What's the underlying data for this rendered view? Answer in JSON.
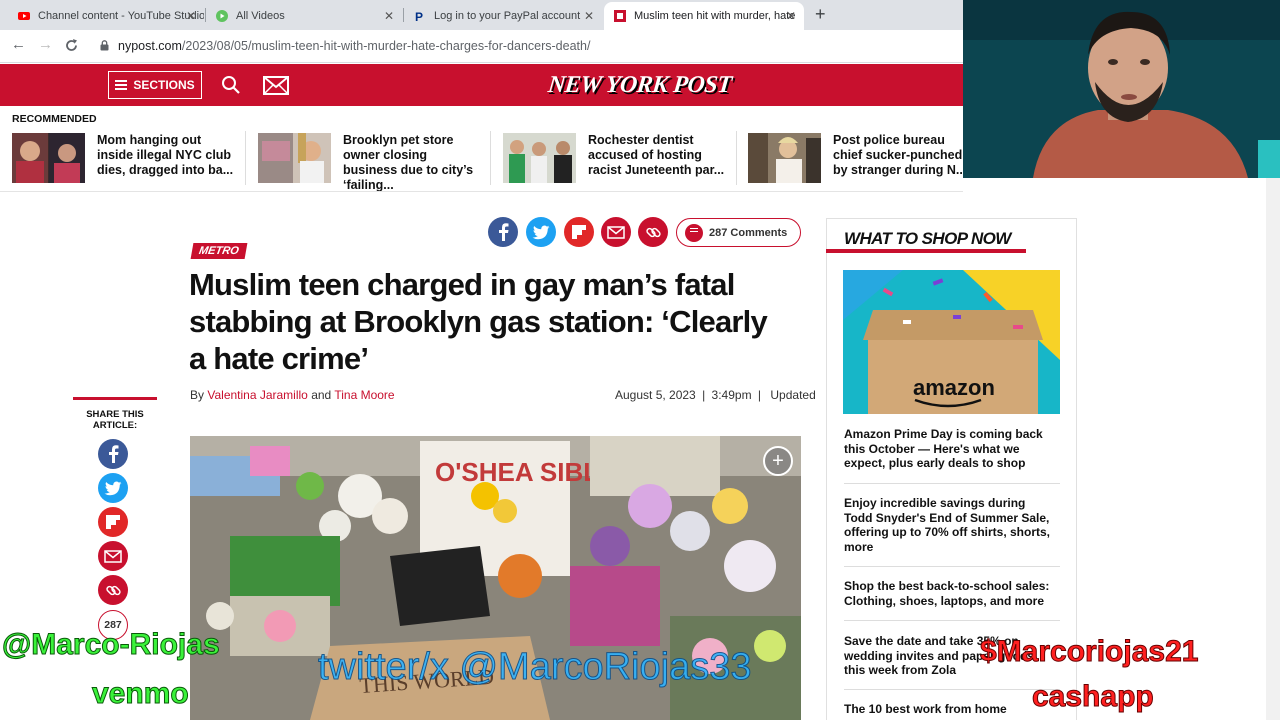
{
  "browser": {
    "tabs": [
      {
        "title": "Channel content - YouTube Studio",
        "active": false,
        "favicon": "youtube-icon"
      },
      {
        "title": "All Videos",
        "active": false,
        "favicon": "play-icon"
      },
      {
        "title": "Log in to your PayPal account",
        "active": false,
        "favicon": "paypal-icon"
      },
      {
        "title": "Muslim teen hit with murder, hate",
        "active": true,
        "favicon": "nypost-icon"
      }
    ],
    "url_host": "nypost.com",
    "url_path": "/2023/08/05/muslim-teen-hit-with-murder-hate-charges-for-dancers-death/"
  },
  "site": {
    "sections_label": "SECTIONS",
    "logo_text": "NEW YORK POST",
    "brand_color": "#c8102e"
  },
  "recommended": {
    "label": "RECOMMENDED",
    "items": [
      {
        "text": "Mom hanging out inside illegal NYC club dies, dragged into ba..."
      },
      {
        "text": "Brooklyn pet store owner closing business due to city’s ‘failing..."
      },
      {
        "text": "Rochester dentist accused of hosting racist Juneteenth par..."
      },
      {
        "text": "Post police bureau chief sucker-punched by stranger during N..."
      }
    ]
  },
  "article": {
    "comments_label": "287 Comments",
    "section_tag": "METRO",
    "headline": "Muslim teen charged in gay man’s fatal stabbing at Brooklyn gas station: ‘Clearly a hate crime’",
    "by": "By",
    "author1": "Valentina Jaramillo",
    "and": "and",
    "author2": "Tina Moore",
    "date": "August 5, 2023",
    "time": "3:49pm",
    "updated": "Updated",
    "photo_sign_text": "O'SHEA SIBLEY",
    "photo_cardboard_text": "THIS WORLD"
  },
  "share_sidebar": {
    "label": "SHARE THIS ARTICLE:",
    "count": "287"
  },
  "shop": {
    "title": "WHAT TO SHOP NOW",
    "image_text": "amazon",
    "items": [
      {
        "text": "Amazon Prime Day is coming back this October — Here's what we expect, plus early deals to shop"
      },
      {
        "text": "Enjoy incredible savings during Todd Snyder's End of Summer Sale, offering up to 70% off shirts, shorts, more"
      },
      {
        "text": "Shop the best back-to-school sales: Clothing, shoes, laptops, and more"
      },
      {
        "text": "Save the date and take 35% on wedding invites and paper goods this week from Zola"
      },
      {
        "text": "The 10 best work from home"
      }
    ]
  },
  "overlays": {
    "venmo_handle": "@Marco-Riojas",
    "venmo_label": "venmo",
    "twitter": "twitter/x @MarcoRiojas33",
    "cashapp_handle": "$Marcoriojas21",
    "cashapp_label": "cashapp"
  }
}
